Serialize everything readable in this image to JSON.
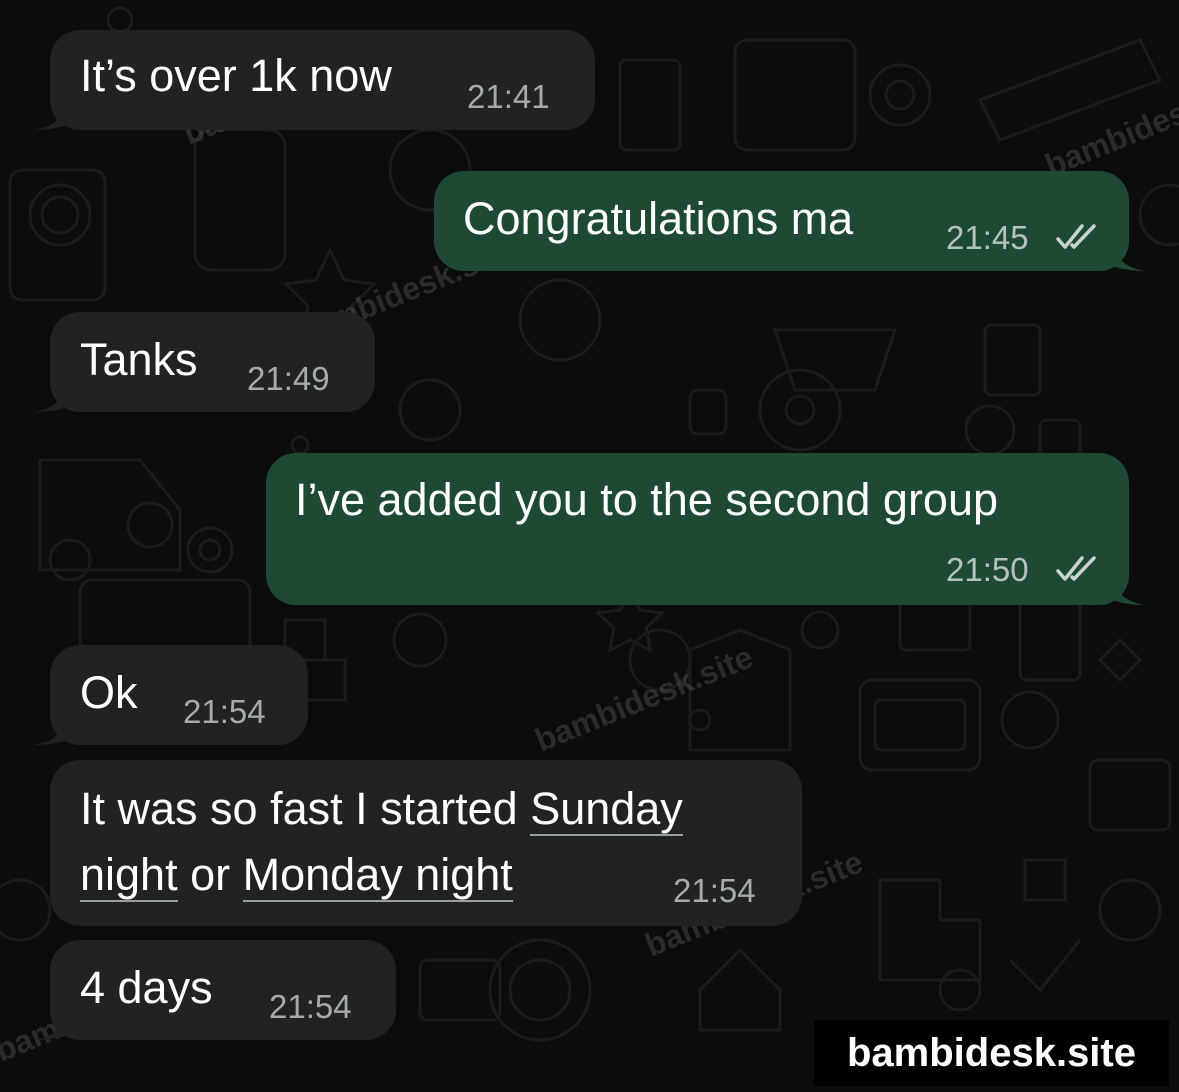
{
  "messages": [
    {
      "direction": "incoming",
      "text": "It’s over 1k now",
      "time": "21:41"
    },
    {
      "direction": "outgoing",
      "text": "Congratulations ma",
      "time": "21:45",
      "status_icon": "double-check-icon"
    },
    {
      "direction": "incoming",
      "text": "Tanks",
      "time": "21:49"
    },
    {
      "direction": "outgoing",
      "text": "I’ve added you to the second group",
      "time": "21:50",
      "status_icon": "double-check-icon"
    },
    {
      "direction": "incoming",
      "text": "Ok",
      "time": "21:54"
    },
    {
      "direction": "incoming",
      "text_parts": [
        "It was so fast I started ",
        "Sunday",
        "night",
        " or ",
        "Monday night"
      ],
      "time": "21:54"
    },
    {
      "direction": "incoming",
      "text": "4 days",
      "time": "21:54"
    }
  ],
  "watermark": {
    "text": "bambidesk.site",
    "badge": "bambidesk.site"
  },
  "colors": {
    "background": "#0b0c0b",
    "incoming_bubble": "#202322",
    "outgoing_bubble": "#1e4a33",
    "time_text": "#a6aaa8",
    "read_ticks": "#c9d3cd"
  }
}
